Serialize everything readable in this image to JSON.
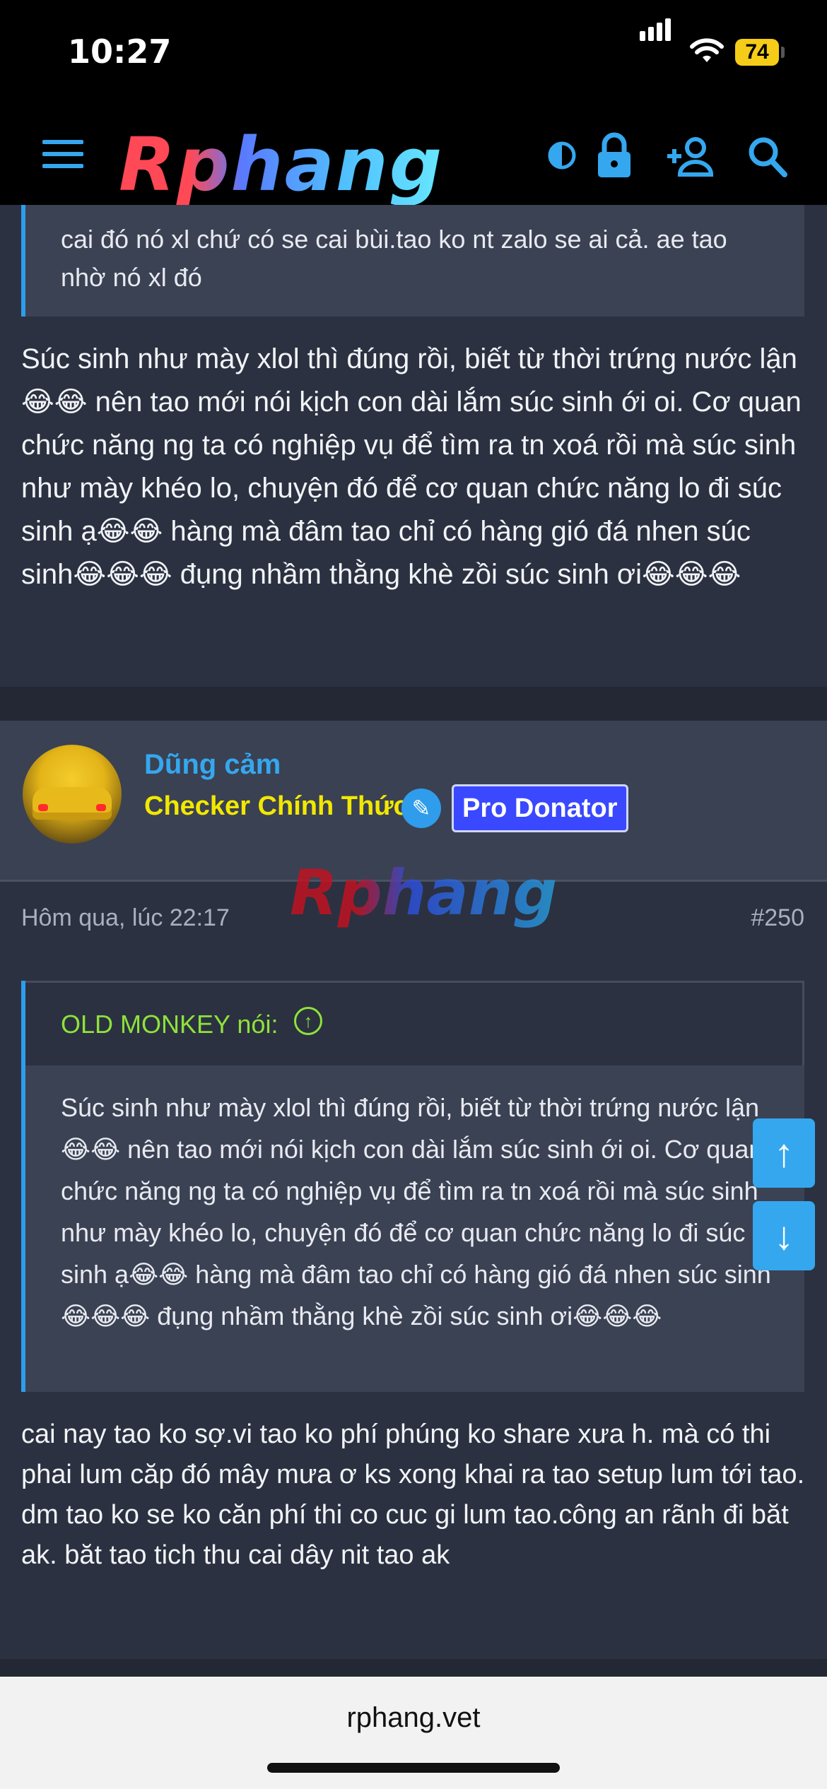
{
  "status_bar": {
    "time": "10:27",
    "battery": "74"
  },
  "nav": {
    "logo": "Rphang",
    "icons": [
      "menu-icon",
      "contrast-icon",
      "lock-icon",
      "add-user-icon",
      "search-icon"
    ],
    "accent": "#35a7ef"
  },
  "previous_post": {
    "quote_tail": "cai đó nó xl chứ có se cai bùi.tao ko nt zalo se ai cả. ae tao nhờ nó xl đó",
    "text": "Súc sinh như mày xlol thì đúng rồi, biết từ thời trứng nước lận😂😂 nên tao mới nói kịch con dài lắm súc sinh ới oi. Cơ quan chức năng ng ta có nghiệp vụ để tìm ra tn xoá rồi mà súc sinh như mày khéo lo, chuyện đó để cơ quan chức năng lo đi súc sinh ạ😂😂 hàng mà đâm tao chỉ có hàng gió đá nhen súc sinh😂😂😂 đụng nhầm thằng khè zồi súc sinh ơi😂😂😂"
  },
  "post": {
    "username": "Dũng cảm",
    "user_title": "Checker Chính Thức",
    "badge": "Pro Donator",
    "watermark": "Rphang",
    "timestamp": "Hôm qua, lúc 22:17",
    "number": "#250",
    "quote_author": "OLD MONKEY nói:",
    "quote_text": "Súc sinh như mày xlol thì đúng rồi, biết từ thời trứng nước lận😂😂 nên tao mới nói kịch con dài lắm súc sinh ới oi. Cơ quan chức năng ng ta có nghiệp vụ để tìm ra tn xoá rồi mà súc sinh như mày khéo lo, chuyện đó để cơ quan chức năng lo đi súc sinh ạ😂😂 hàng mà đâm tao chỉ có hàng gió đá nhen súc sinh😂😂😂 đụng nhầm thằng khè zồi súc sinh ơi😂😂😂",
    "text": "cai nay tao ko sợ.vi tao ko phí phúng ko share xưa h. mà có thi phai lum căp đó mây mưa ơ ks xong khai ra tao setup lum tới tao. dm tao ko se ko căn phí thi co cuc gi lum tao.công an rãnh đi băt ak. băt tao tich thu cai dây nit tao ak"
  },
  "scroll": {
    "up": "↑",
    "down": "↓"
  },
  "browser": {
    "url": "rphang.vet"
  }
}
